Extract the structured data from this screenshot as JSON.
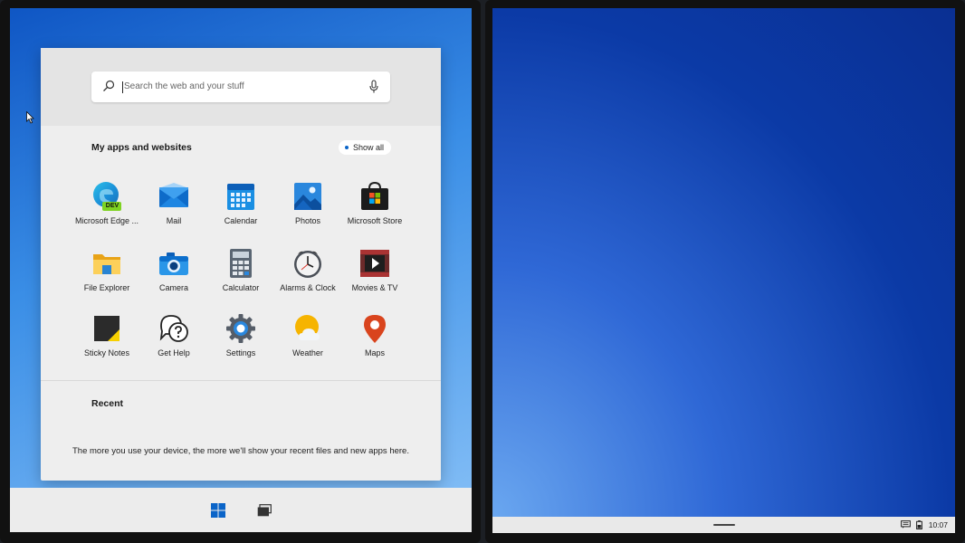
{
  "search": {
    "placeholder": "Search the web and your stuff"
  },
  "apps": {
    "title": "My apps and websites",
    "show_all": "Show all",
    "items": [
      {
        "label": "Microsoft Edge ...",
        "icon": "edge-dev-icon"
      },
      {
        "label": "Mail",
        "icon": "mail-icon"
      },
      {
        "label": "Calendar",
        "icon": "calendar-icon"
      },
      {
        "label": "Photos",
        "icon": "photos-icon"
      },
      {
        "label": "Microsoft Store",
        "icon": "store-icon"
      },
      {
        "label": "File Explorer",
        "icon": "file-explorer-icon"
      },
      {
        "label": "Camera",
        "icon": "camera-icon"
      },
      {
        "label": "Calculator",
        "icon": "calculator-icon"
      },
      {
        "label": "Alarms & Clock",
        "icon": "alarm-clock-icon"
      },
      {
        "label": "Movies & TV",
        "icon": "movies-icon"
      },
      {
        "label": "Sticky Notes",
        "icon": "sticky-notes-icon"
      },
      {
        "label": "Get Help",
        "icon": "get-help-icon"
      },
      {
        "label": "Settings",
        "icon": "settings-icon"
      },
      {
        "label": "Weather",
        "icon": "weather-icon"
      },
      {
        "label": "Maps",
        "icon": "maps-icon"
      }
    ],
    "edge_badge": "DEV"
  },
  "recent": {
    "title": "Recent",
    "message": "The more you use your device, the more we'll show your recent files and new apps here."
  },
  "tray": {
    "time": "10:07"
  },
  "colors": {
    "accent": "#0a64c8",
    "wallpaper_dark": "#0a2f92",
    "wallpaper_light": "#7fbbf5"
  }
}
